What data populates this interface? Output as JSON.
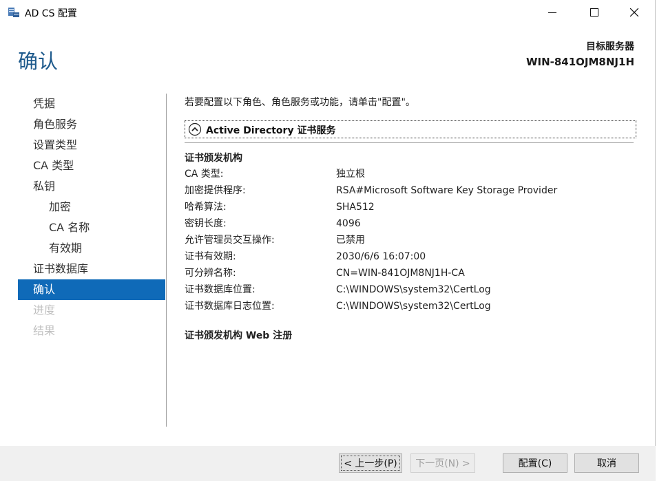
{
  "window": {
    "title": "AD CS 配置",
    "icon": "server-manager-icon"
  },
  "header": {
    "page_title": "确认",
    "target_label": "目标服务器",
    "target_server": "WIN-841OJM8NJ1H"
  },
  "nav": {
    "items": [
      {
        "label": "凭据",
        "state": "normal",
        "level": 0
      },
      {
        "label": "角色服务",
        "state": "normal",
        "level": 0
      },
      {
        "label": "设置类型",
        "state": "normal",
        "level": 0
      },
      {
        "label": "CA 类型",
        "state": "normal",
        "level": 0
      },
      {
        "label": "私钥",
        "state": "normal",
        "level": 0
      },
      {
        "label": "加密",
        "state": "normal",
        "level": 1
      },
      {
        "label": "CA 名称",
        "state": "normal",
        "level": 1
      },
      {
        "label": "有效期",
        "state": "normal",
        "level": 1
      },
      {
        "label": "证书数据库",
        "state": "normal",
        "level": 0
      },
      {
        "label": "确认",
        "state": "active",
        "level": 0
      },
      {
        "label": "进度",
        "state": "disabled",
        "level": 0
      },
      {
        "label": "结果",
        "state": "disabled",
        "level": 0
      }
    ]
  },
  "content": {
    "intro": "若要配置以下角色、角色服务或功能，请单击\"配置\"。",
    "section_title": "Active Directory 证书服务",
    "ca_group_title": "证书颁发机构",
    "rows": [
      {
        "key": "CA 类型:",
        "value": "独立根"
      },
      {
        "key": "加密提供程序:",
        "value": "RSA#Microsoft Software Key Storage Provider"
      },
      {
        "key": "哈希算法:",
        "value": "SHA512"
      },
      {
        "key": "密钥长度:",
        "value": "4096"
      },
      {
        "key": "允许管理员交互操作:",
        "value": "已禁用"
      },
      {
        "key": "证书有效期:",
        "value": "2030/6/6 16:07:00"
      },
      {
        "key": "可分辨名称:",
        "value": "CN=WIN-841OJM8NJ1H-CA"
      },
      {
        "key": "证书数据库位置:",
        "value": "C:\\WINDOWS\\system32\\CertLog"
      },
      {
        "key": "证书数据库日志位置:",
        "value": "C:\\WINDOWS\\system32\\CertLog"
      }
    ],
    "web_group_title": "证书颁发机构 Web 注册"
  },
  "footer": {
    "prev_label": "< 上一步(P)",
    "next_label": "下一页(N) >",
    "config_label": "配置(C)",
    "cancel_label": "取消"
  },
  "colors": {
    "accent": "#0f6ab8",
    "title_blue": "#1e5a8c",
    "disabled": "#c0c0c0",
    "footer_bg": "#f0f0f0"
  }
}
